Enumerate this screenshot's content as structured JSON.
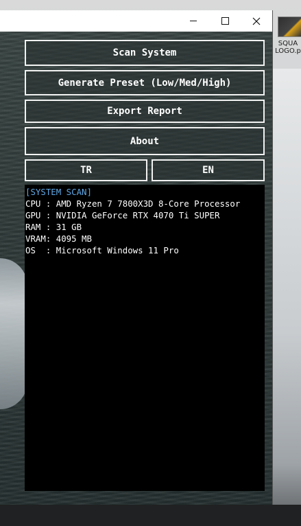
{
  "desktop": {
    "icon_label_1": "SQUA",
    "icon_label_2": "LOGO.p"
  },
  "window": {
    "controls": {
      "minimize": "minimize-icon",
      "maximize": "maximize-icon",
      "close": "close-icon"
    }
  },
  "buttons": {
    "scan": "Scan System",
    "preset": "Generate Preset (Low/Med/High)",
    "export": "Export Report",
    "about": "About",
    "lang_tr": "TR",
    "lang_en": "EN"
  },
  "console": {
    "header": "[SYSTEM SCAN]",
    "lines": [
      "CPU : AMD Ryzen 7 7800X3D 8-Core Processor",
      "GPU : NVIDIA GeForce RTX 4070 Ti SUPER",
      "RAM : 31 GB",
      "VRAM: 4095 MB",
      "OS  : Microsoft Windows 11 Pro"
    ]
  },
  "colors": {
    "console_header": "#5ea8e6",
    "console_text": "#ffffff",
    "button_border": "#f2f2f2"
  }
}
